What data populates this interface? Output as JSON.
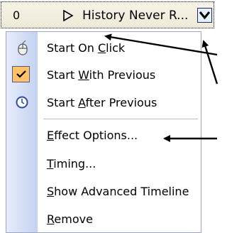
{
  "item": {
    "order": "0",
    "name": "History Never R..."
  },
  "menu": {
    "items": [
      {
        "pre": "Start On ",
        "key": "C",
        "post": "lick"
      },
      {
        "pre": "Start ",
        "key": "W",
        "post": "ith Previous"
      },
      {
        "pre": "Start ",
        "key": "A",
        "post": "fter Previous"
      },
      {
        "pre": "",
        "key": "E",
        "post": "ffect Options..."
      },
      {
        "pre": "",
        "key": "T",
        "post": "iming..."
      },
      {
        "pre": "",
        "key": "S",
        "post": "how Advanced Timeline"
      },
      {
        "pre": "",
        "key": "R",
        "post": "emove"
      }
    ]
  },
  "icons": {
    "item_1": "mouse-icon",
    "item_2": "check-icon",
    "item_3": "clock-icon"
  },
  "colors": {
    "check_highlight": "#ffc268",
    "gutter": "#c4d2f0",
    "accent": "#1a2c6d"
  }
}
